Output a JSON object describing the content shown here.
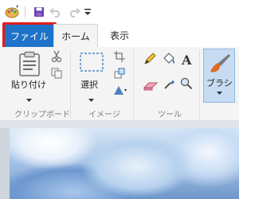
{
  "quick_access": {
    "app_menu_icon": "paint-palette-icon",
    "save_icon": "save-icon",
    "undo_icon": "undo-icon",
    "redo_icon": "redo-icon",
    "customize_icon": "customize-quick-access-icon"
  },
  "tabs": [
    {
      "label": "ファイル"
    },
    {
      "label": "ホーム"
    },
    {
      "label": "表示"
    }
  ],
  "ribbon": {
    "clipboard": {
      "paste_label": "貼り付け",
      "group_label": "クリップボード"
    },
    "image": {
      "select_label": "選択",
      "group_label": "イメージ"
    },
    "tools": {
      "group_label": "ツール"
    },
    "brush": {
      "label": "ブラシ"
    }
  },
  "colors": {
    "file_tab_bg": "#1e73c8",
    "highlight_border": "#e21b1b",
    "ribbon_bg": "#f4f4f4",
    "brush_bg": "#c7dcf2"
  }
}
